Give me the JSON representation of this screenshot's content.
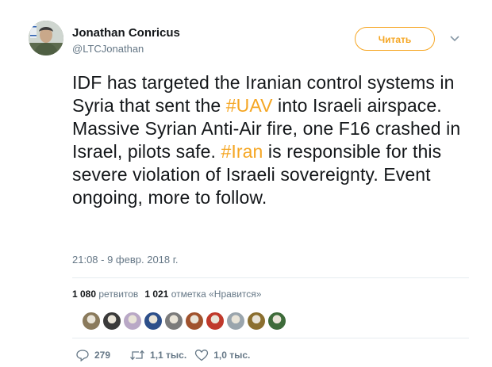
{
  "author": {
    "name": "Jonathan Conricus",
    "handle": "@LTCJonathan"
  },
  "follow_label": "Читать",
  "tweet": {
    "segments": [
      {
        "text": "IDF has targeted the Iranian control systems in Syria that sent the ",
        "tag": false
      },
      {
        "text": "#UAV",
        "tag": true
      },
      {
        "text": " into Israeli airspace. Massive Syrian Anti-Air fire, one F16 crashed in Israel, pilots safe. ",
        "tag": false
      },
      {
        "text": "#Iran",
        "tag": true
      },
      {
        "text": " is responsible for this severe violation of Israeli sovereignty. Event ongoing, more to follow.",
        "tag": false
      }
    ],
    "timestamp": "21:08 - 9 февр. 2018 г."
  },
  "stats": {
    "retweets_count": "1 080",
    "retweets_label": "ретвитов",
    "likes_count": "1 021",
    "likes_label": "отметка «Нравится»"
  },
  "likers": [
    {
      "color": "#8a7a5c"
    },
    {
      "color": "#3a3a3a"
    },
    {
      "color": "#b9a8c6"
    },
    {
      "color": "#2d4f8a"
    },
    {
      "color": "#7b7b7b"
    },
    {
      "color": "#a0522d"
    },
    {
      "color": "#c0392b"
    },
    {
      "color": "#9aa5ad"
    },
    {
      "color": "#8b6f2f"
    },
    {
      "color": "#3e6b3a"
    }
  ],
  "actions": {
    "reply_count": "279",
    "retweet_count": "1,1 тыс.",
    "like_count": "1,0 тыс."
  },
  "colors": {
    "accent": "#f5a623",
    "muted": "#657786",
    "text": "#14171a"
  }
}
